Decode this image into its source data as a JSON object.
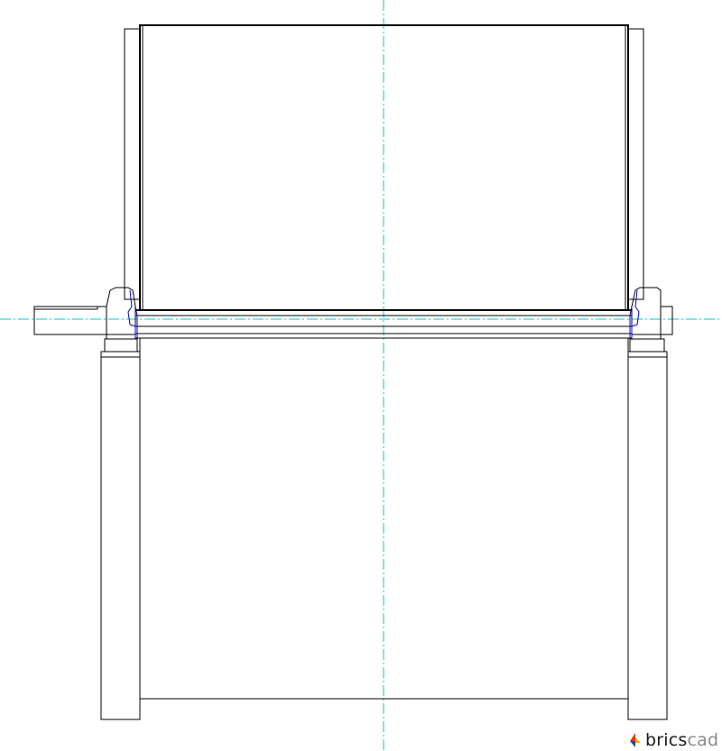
{
  "diagram": {
    "colors": {
      "background": "#ffffff",
      "outline": "#000000",
      "hidden_detail": "#0000cc",
      "centerline": "#00cccc"
    }
  },
  "watermark": {
    "text_part1": "brics",
    "text_part2": "cad",
    "icon": "bricscad-logo-icon",
    "icon_colors": [
      "#e63312",
      "#f6a800",
      "#1f4e9e"
    ]
  }
}
